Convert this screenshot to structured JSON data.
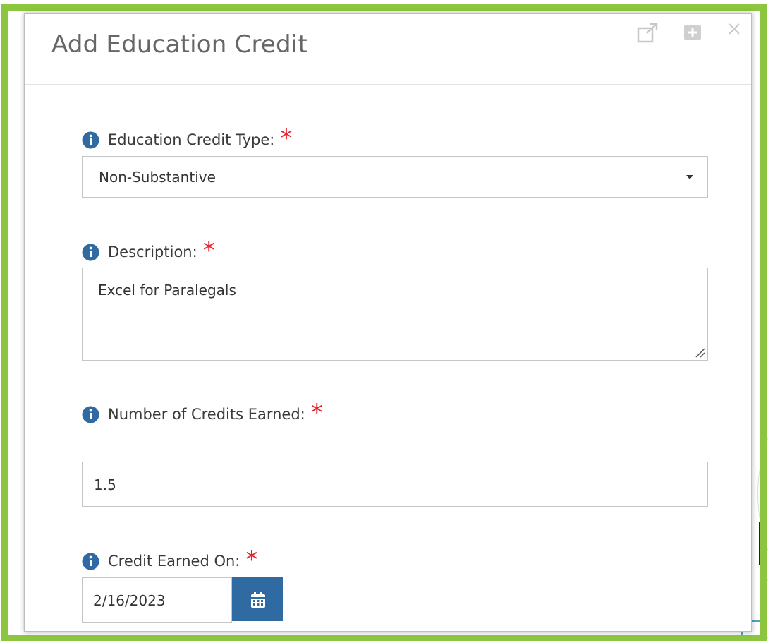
{
  "modal": {
    "title": "Add Education Credit",
    "header_icons": [
      "external-link-icon",
      "plus-square-icon",
      "close-icon"
    ]
  },
  "fields": {
    "credit_type": {
      "label": "Education Credit Type:",
      "required_marker": "*",
      "value": "Non-Substantive"
    },
    "description": {
      "label": "Description:",
      "required_marker": "*",
      "value": "Excel for Paralegals"
    },
    "credits_earned": {
      "label": "Number of Credits Earned:",
      "required_marker": "*",
      "value": "1.5"
    },
    "earned_on": {
      "label": "Credit Earned On:",
      "required_marker": "*",
      "value": "2/16/2023",
      "button_icon": "calendar-icon"
    }
  },
  "colors": {
    "frame": "#8cc63f",
    "required": "#e8202a",
    "info_icon": "#2f6aa3",
    "calendar_button": "#2f6aa3"
  }
}
